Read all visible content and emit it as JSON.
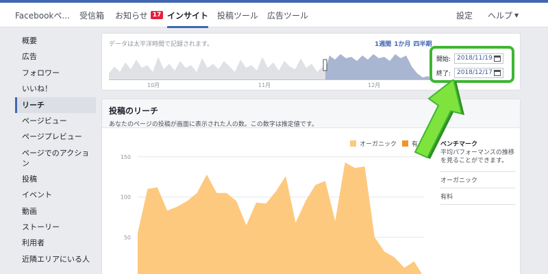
{
  "header": {
    "page_name": "Facebookペ...",
    "tabs": [
      {
        "label": "受信箱"
      },
      {
        "label": "お知らせ",
        "badge": "17"
      },
      {
        "label": "インサイト"
      },
      {
        "label": "投稿ツール"
      },
      {
        "label": "広告ツール"
      }
    ],
    "settings_label": "設定",
    "help_label": "ヘルプ"
  },
  "sidebar": {
    "items": [
      {
        "label": "概要"
      },
      {
        "label": "広告"
      },
      {
        "label": "フォロワー"
      },
      {
        "label": "いいね！"
      },
      {
        "label": "リーチ"
      },
      {
        "label": "ページビュー"
      },
      {
        "label": "ページプレビュー"
      },
      {
        "label": "ページでのアクション"
      },
      {
        "label": "投稿"
      },
      {
        "label": "イベント"
      },
      {
        "label": "動画"
      },
      {
        "label": "ストーリー"
      },
      {
        "label": "利用者"
      },
      {
        "label": "近隣エリアにいる人"
      }
    ]
  },
  "date_range": {
    "note": "データは太平洋時間で記録されます。",
    "periods": [
      "1週間",
      "1か月",
      "四半期"
    ],
    "months": [
      "10月",
      "11月",
      "12月"
    ],
    "start_label": "開始:",
    "start_value": "2018/11/19",
    "end_label": "終了:",
    "end_value": "2018/12/17"
  },
  "reach_panel": {
    "title": "投稿のリーチ",
    "subtitle": "あなたのページの投稿が画面に表示された人の数。この数字は推定値です。",
    "legend": [
      "オーガニック",
      "有"
    ],
    "benchmark_title": "ベンチマーク",
    "benchmark_desc": "平均パフォーマンスの推移を見ることができます。",
    "benchmark_rows": [
      "オーガニック",
      "有料"
    ]
  },
  "colors": {
    "organic": "#fdc97e",
    "paid": "#f59425",
    "accent": "#4267b2",
    "highlight": "#3fb532"
  },
  "chart_data": {
    "type": "area",
    "series": [
      {
        "name": "オーガニック",
        "values": [
          55,
          110,
          112,
          83,
          88,
          95,
          105,
          128,
          105,
          105,
          95,
          65,
          93,
          92,
          107,
          126,
          68,
          95,
          115,
          120,
          70,
          143,
          136,
          138,
          50,
          32,
          25,
          12,
          20,
          0
        ]
      }
    ],
    "yticks": [
      "150",
      "100",
      "50"
    ],
    "ylim": [
      0,
      155
    ],
    "grid": true
  }
}
